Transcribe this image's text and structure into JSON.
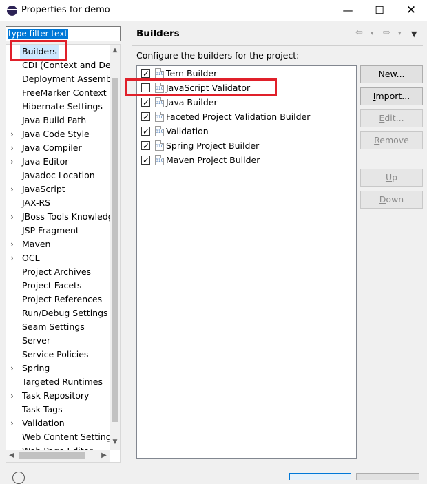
{
  "window": {
    "title": "Properties for demo",
    "minimize_glyph": "—",
    "maximize_glyph": "☐",
    "close_glyph": "✕"
  },
  "filter": {
    "value": "type filter text"
  },
  "tree": {
    "items": [
      {
        "label": "Builders",
        "expandable": false,
        "selected": true
      },
      {
        "label": "CDI (Context and Dependency Injection)",
        "expandable": false
      },
      {
        "label": "Deployment Assembly",
        "expandable": false
      },
      {
        "label": "FreeMarker Context",
        "expandable": false
      },
      {
        "label": "Hibernate Settings",
        "expandable": false
      },
      {
        "label": "Java Build Path",
        "expandable": false
      },
      {
        "label": "Java Code Style",
        "expandable": true
      },
      {
        "label": "Java Compiler",
        "expandable": true
      },
      {
        "label": "Java Editor",
        "expandable": true
      },
      {
        "label": "Javadoc Location",
        "expandable": false
      },
      {
        "label": "JavaScript",
        "expandable": true
      },
      {
        "label": "JAX-RS",
        "expandable": false
      },
      {
        "label": "JBoss Tools Knowledge Base",
        "expandable": true
      },
      {
        "label": "JSP Fragment",
        "expandable": false
      },
      {
        "label": "Maven",
        "expandable": true
      },
      {
        "label": "OCL",
        "expandable": true
      },
      {
        "label": "Project Archives",
        "expandable": false
      },
      {
        "label": "Project Facets",
        "expandable": false
      },
      {
        "label": "Project References",
        "expandable": false
      },
      {
        "label": "Run/Debug Settings",
        "expandable": false
      },
      {
        "label": "Seam Settings",
        "expandable": false
      },
      {
        "label": "Server",
        "expandable": false
      },
      {
        "label": "Service Policies",
        "expandable": false
      },
      {
        "label": "Spring",
        "expandable": true
      },
      {
        "label": "Targeted Runtimes",
        "expandable": false
      },
      {
        "label": "Task Repository",
        "expandable": true
      },
      {
        "label": "Task Tags",
        "expandable": false
      },
      {
        "label": "Validation",
        "expandable": true
      },
      {
        "label": "Web Content Settings",
        "expandable": false
      },
      {
        "label": "Web Page Editor",
        "expandable": false
      }
    ]
  },
  "page": {
    "title": "Builders",
    "description": "Configure the builders for the project:",
    "nav": {
      "back": "⇦",
      "forward": "⇨",
      "dropdown": "▾",
      "menu": "▼"
    }
  },
  "builders": [
    {
      "label": "Tern Builder",
      "checked": true
    },
    {
      "label": "JavaScript Validator",
      "checked": false
    },
    {
      "label": "Java Builder",
      "checked": true
    },
    {
      "label": "Faceted Project Validation Builder",
      "checked": true
    },
    {
      "label": "Validation",
      "checked": true
    },
    {
      "label": "Spring Project Builder",
      "checked": true
    },
    {
      "label": "Maven Project Builder",
      "checked": true
    }
  ],
  "builder_icon_text": "010",
  "buttons": [
    {
      "label": "New...",
      "mnemonic_index": 0,
      "enabled": true
    },
    {
      "label": "Import...",
      "mnemonic_index": 0,
      "enabled": true
    },
    {
      "label": "Edit...",
      "mnemonic_index": 0,
      "enabled": false
    },
    {
      "label": "Remove",
      "mnemonic_index": 0,
      "enabled": false
    },
    {
      "label": "Up",
      "mnemonic_index": 0,
      "enabled": false
    },
    {
      "label": "Down",
      "mnemonic_index": 0,
      "enabled": false
    }
  ],
  "colors": {
    "accent": "#0078d7",
    "highlight_box": "#e0202a",
    "selection": "#cce8ff"
  }
}
